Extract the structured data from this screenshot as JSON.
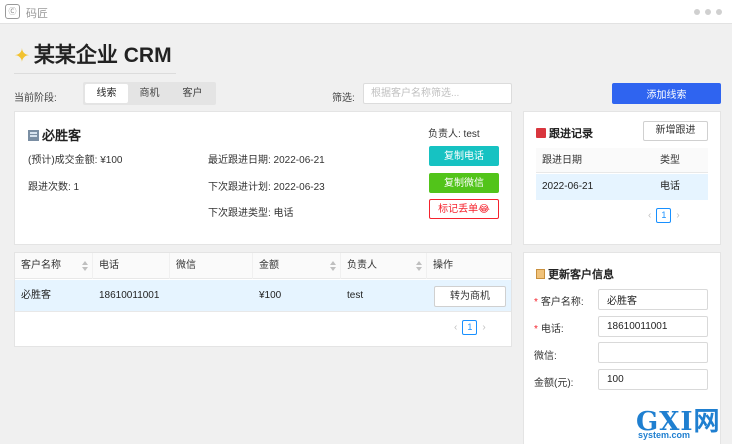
{
  "app": {
    "name": "码匠"
  },
  "page": {
    "title": "某某企业 CRM"
  },
  "stage": {
    "label": "当前阶段:",
    "tabs": [
      {
        "label": "线索",
        "active": true
      },
      {
        "label": "商机"
      },
      {
        "label": "客户"
      }
    ]
  },
  "filter": {
    "label": "筛选:",
    "placeholder": "根据客户名称筛选..."
  },
  "add_button": "添加线索",
  "client": {
    "name": "必胜客",
    "owner": "负责人: test",
    "deal_amount": "(预计)成交金额: ¥100",
    "follow_count": "跟进次数: 1",
    "last_follow": "最近跟进日期: 2022-06-21",
    "next_plan": "下次跟进计划: 2022-06-23",
    "next_type": "下次跟进类型: 电话",
    "buttons": {
      "copy_phone": "复制电话",
      "copy_wechat": "复制微信",
      "mark_lost": "标记丢单😂"
    }
  },
  "table": {
    "headers": [
      "客户名称",
      "电话",
      "微信",
      "金额",
      "负责人",
      "操作"
    ],
    "rows": [
      {
        "name": "必胜客",
        "phone": "18610011001",
        "wechat": "",
        "amount": "¥100",
        "owner": "test",
        "action": "转为商机"
      }
    ],
    "page": "1"
  },
  "follow": {
    "title": "跟进记录",
    "new_button": "新增跟进",
    "headers": [
      "跟进日期",
      "类型"
    ],
    "rows": [
      {
        "date": "2022-06-21",
        "type": "电话"
      }
    ],
    "page": "1"
  },
  "update": {
    "title": "更新客户信息",
    "fields": [
      {
        "label": "客户名称:",
        "required": true,
        "value": "必胜客"
      },
      {
        "label": "电话:",
        "required": true,
        "value": "18610011001"
      },
      {
        "label": "微信:",
        "required": false,
        "value": ""
      },
      {
        "label": "金额(元):",
        "required": false,
        "value": "100"
      }
    ]
  },
  "watermark": {
    "text": "GXI网",
    "sub": "system.com"
  }
}
